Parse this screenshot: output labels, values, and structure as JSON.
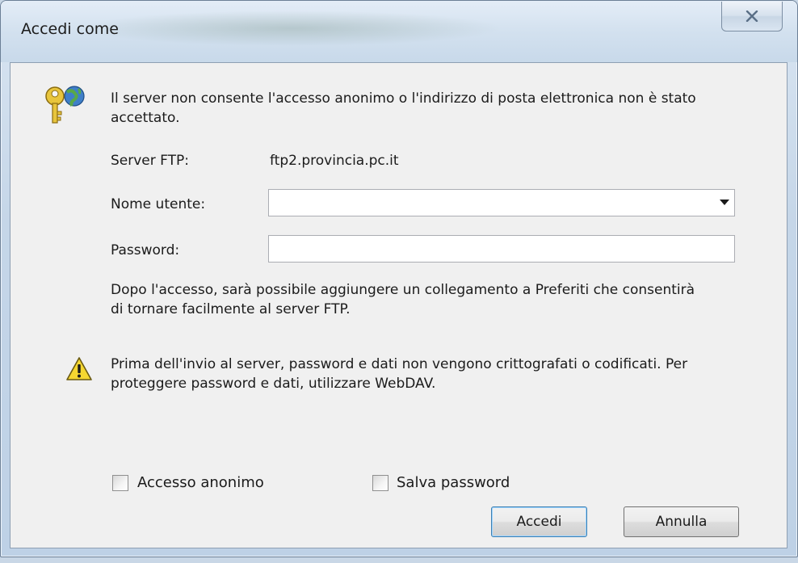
{
  "window": {
    "title": "Accedi come",
    "close_icon": "close-icon"
  },
  "message": {
    "line1": "Il server non consente l'accesso anonimo o l'indirizzo di posta elettronica non è stato",
    "line2": "accettato."
  },
  "server": {
    "label": "Server FTP:",
    "value": "ftp2.provincia.pc.it"
  },
  "username": {
    "label": "Nome utente:",
    "value": ""
  },
  "password": {
    "label": "Password:",
    "value": ""
  },
  "info": {
    "line1": "Dopo l'accesso, sarà possibile aggiungere un collegamento a Preferiti che consentirà",
    "line2": "di tornare facilmente al server FTP."
  },
  "warning": {
    "line1": "Prima dell'invio al server, password e dati non vengono crittografati o codificati. Per",
    "line2": "proteggere password e dati, utilizzare WebDAV."
  },
  "options": {
    "anonymous_label": "Accesso anonimo",
    "anonymous_checked": false,
    "save_password_label": "Salva password",
    "save_password_checked": false
  },
  "buttons": {
    "login": "Accedi",
    "cancel": "Annulla"
  },
  "icons": {
    "key": "key-globe-icon",
    "warning": "warning-icon"
  }
}
